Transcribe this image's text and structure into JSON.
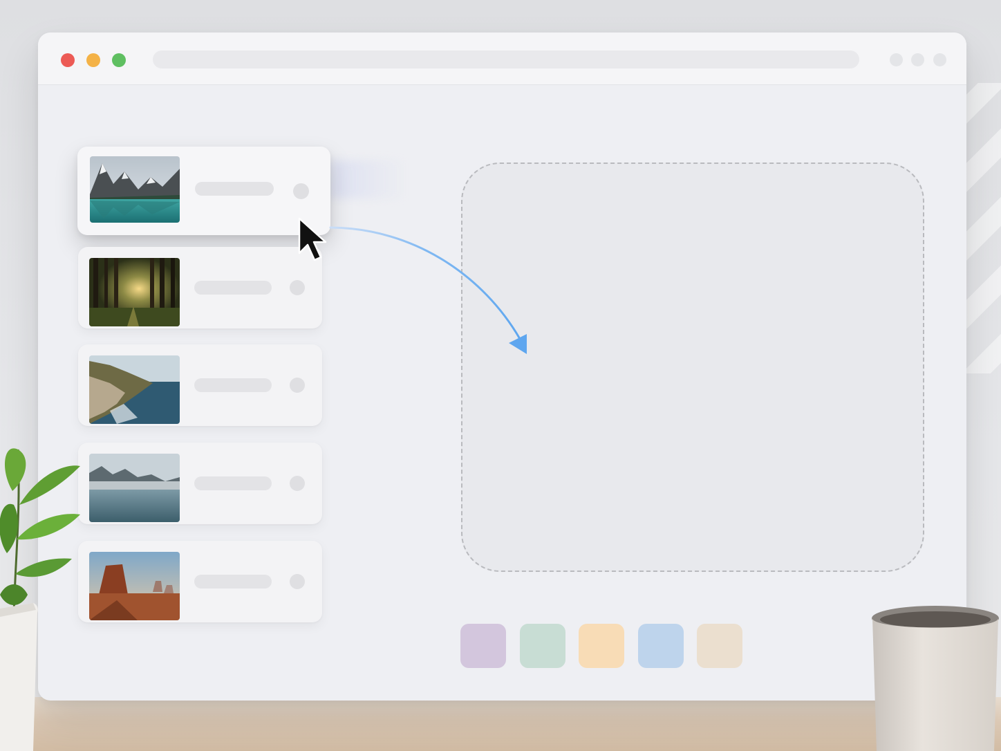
{
  "window": {
    "traffic_lights": {
      "close": "#ec5a55",
      "minimize": "#f4b247",
      "maximize": "#5fbf61"
    },
    "address_bar": "",
    "menu_dots": 3
  },
  "image_list": {
    "items": [
      {
        "scene": "mountain-lake",
        "label": "",
        "state": "dragging"
      },
      {
        "scene": "forest-sunrise",
        "label": ""
      },
      {
        "scene": "coastal-cliffs",
        "label": ""
      },
      {
        "scene": "misty-lake",
        "label": ""
      },
      {
        "scene": "desert-butte",
        "label": ""
      }
    ]
  },
  "drop_zone": {
    "label": ""
  },
  "drag_arrow": {
    "color": "#6aaef2"
  },
  "swatches": [
    "#d3c6dd",
    "#c8ddd4",
    "#f8dcb6",
    "#bed4ec",
    "#ebdfcf"
  ]
}
